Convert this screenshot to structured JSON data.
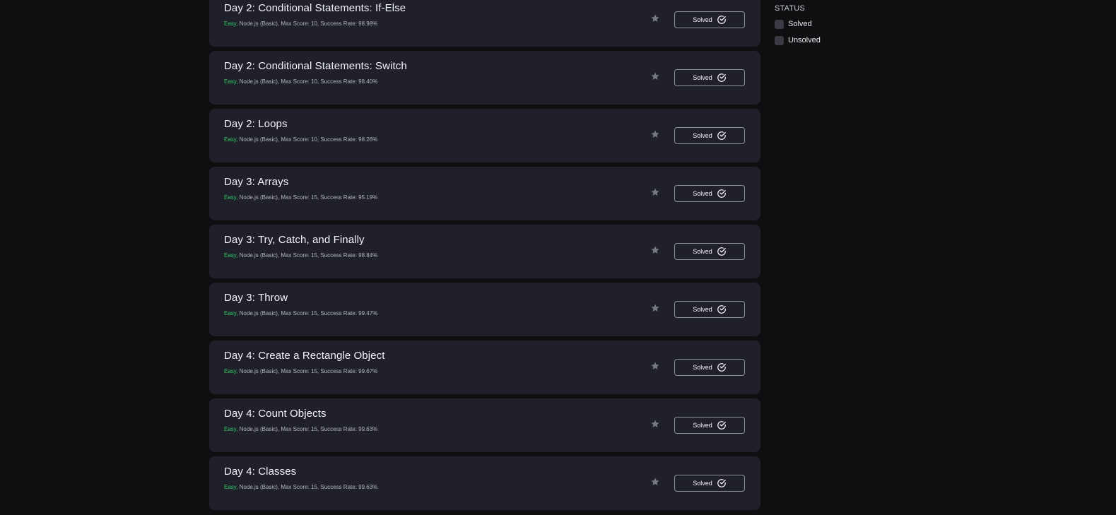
{
  "challenges": [
    {
      "title": "Day 2: Conditional Statements: If-Else",
      "difficulty": "Easy,",
      "details": " Node.js (Basic), Max Score: 10, Success Rate: 98.98%",
      "status": "Solved"
    },
    {
      "title": "Day 2: Conditional Statements: Switch",
      "difficulty": "Easy,",
      "details": " Node.js (Basic), Max Score: 10, Success Rate: 98.40%",
      "status": "Solved"
    },
    {
      "title": "Day 2: Loops",
      "difficulty": "Easy,",
      "details": " Node.js (Basic), Max Score: 10, Success Rate: 98.26%",
      "status": "Solved"
    },
    {
      "title": "Day 3: Arrays",
      "difficulty": "Easy,",
      "details": " Node.js (Basic), Max Score: 15, Success Rate: 95.19%",
      "status": "Solved"
    },
    {
      "title": "Day 3: Try, Catch, and Finally",
      "difficulty": "Easy,",
      "details": " Node.js (Basic), Max Score: 15, Success Rate: 98.84%",
      "status": "Solved"
    },
    {
      "title": "Day 3: Throw",
      "difficulty": "Easy,",
      "details": " Node.js (Basic), Max Score: 15, Success Rate: 99.47%",
      "status": "Solved"
    },
    {
      "title": "Day 4: Create a Rectangle Object",
      "difficulty": "Easy,",
      "details": " Node.js (Basic), Max Score: 15, Success Rate: 99.67%",
      "status": "Solved"
    },
    {
      "title": "Day 4: Count Objects",
      "difficulty": "Easy,",
      "details": " Node.js (Basic), Max Score: 15, Success Rate: 99.63%",
      "status": "Solved"
    },
    {
      "title": "Day 4: Classes",
      "difficulty": "Easy,",
      "details": " Node.js (Basic), Max Score: 15, Success Rate: 99.63%",
      "status": "Solved"
    }
  ],
  "filter": {
    "heading": "STATUS",
    "options": [
      {
        "label": "Solved",
        "checked": false
      },
      {
        "label": "Unsolved",
        "checked": false
      }
    ]
  },
  "icons": {
    "bookmark": "star-icon",
    "solved": "check-circle-icon"
  },
  "colors": {
    "background": "#0e0f11",
    "card": "#1f2029",
    "easy": "#2ec866",
    "star": "#777983"
  }
}
